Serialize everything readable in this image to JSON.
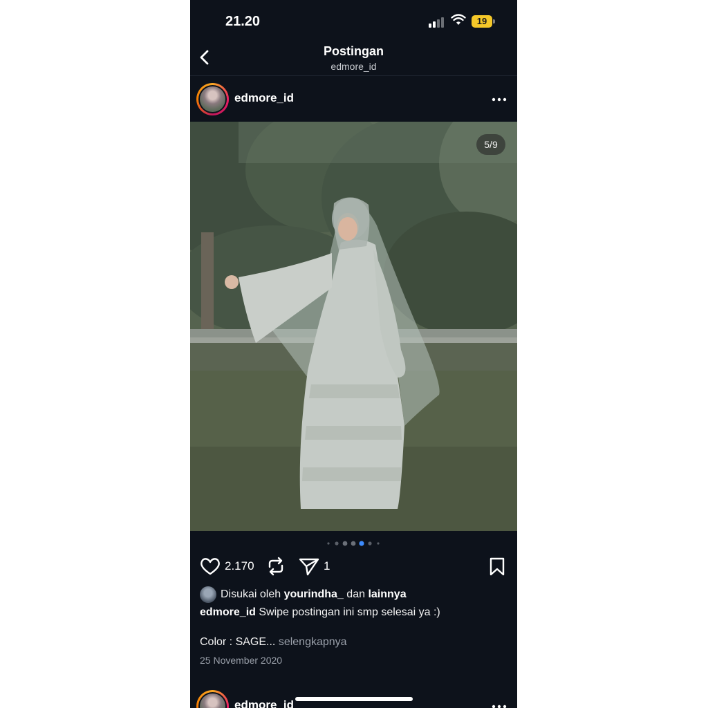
{
  "status_bar": {
    "time": "21.20",
    "battery": "19",
    "icons": [
      "signal-icon",
      "wifi-icon",
      "battery-icon"
    ]
  },
  "nav": {
    "title": "Postingan",
    "subtitle": "edmore_id",
    "back_icon": "chevron-left-icon"
  },
  "post": {
    "username": "edmore_id",
    "more_icon": "ellipsis-icon",
    "image_counter": "5/9",
    "carousel": {
      "total_visible_dots": 7,
      "active_index": 4
    },
    "likes": "2.170",
    "shares": "1",
    "liked_by": {
      "prefix": "Disukai oleh",
      "user": "yourindha_",
      "joiner": "dan",
      "others": "lainnya"
    },
    "caption": {
      "username": "edmore_id",
      "text": "Swipe postingan ini smp selesai ya :)"
    },
    "color_line": "Color : SAGE...",
    "see_more": "selengkapnya",
    "date": "25 November 2020"
  },
  "next_post": {
    "username": "edmore_id"
  },
  "colors": {
    "background": "#0d121b",
    "active_dot": "#3d8bfd",
    "muted_text": "#9aa0aa"
  }
}
